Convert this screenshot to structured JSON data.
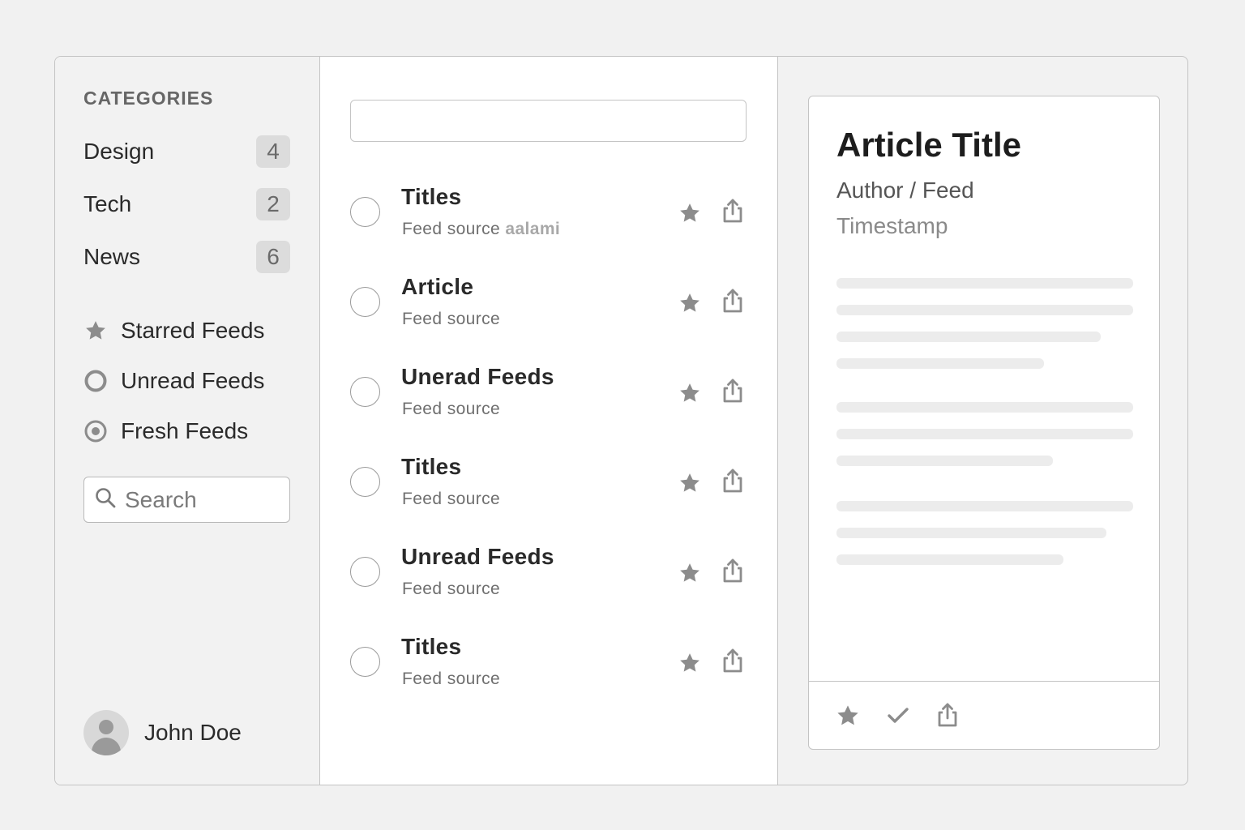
{
  "sidebar": {
    "heading": "CATEGORIES",
    "categories": [
      {
        "label": "Design",
        "count": "4"
      },
      {
        "label": "Tech",
        "count": "2"
      },
      {
        "label": "News",
        "count": "6"
      }
    ],
    "filters": [
      {
        "label": "Starred Feeds",
        "icon": "star-icon"
      },
      {
        "label": "Unread Feeds",
        "icon": "ring-icon"
      },
      {
        "label": "Fresh Feeds",
        "icon": "target-icon"
      }
    ],
    "search_placeholder": "Search",
    "user_name": "John Doe"
  },
  "list": {
    "search_value": "",
    "items": [
      {
        "title": "Titles",
        "source": "Feed source",
        "extra": "aalami"
      },
      {
        "title": "Article",
        "source": "Feed source"
      },
      {
        "title": "Unerad Feeds",
        "source": "Feed source"
      },
      {
        "title": "Titles",
        "source": "Feed source"
      },
      {
        "title": "Unread Feeds",
        "source": "Feed source"
      },
      {
        "title": "Titles",
        "source": "Feed source"
      }
    ]
  },
  "reader": {
    "title": "Article Title",
    "author": "Author / Feed",
    "timestamp": "Timestamp"
  },
  "colors": {
    "icon_gray": "#8c8c8c",
    "badge_bg": "#dcdcdc",
    "border": "#c4c4c4"
  }
}
